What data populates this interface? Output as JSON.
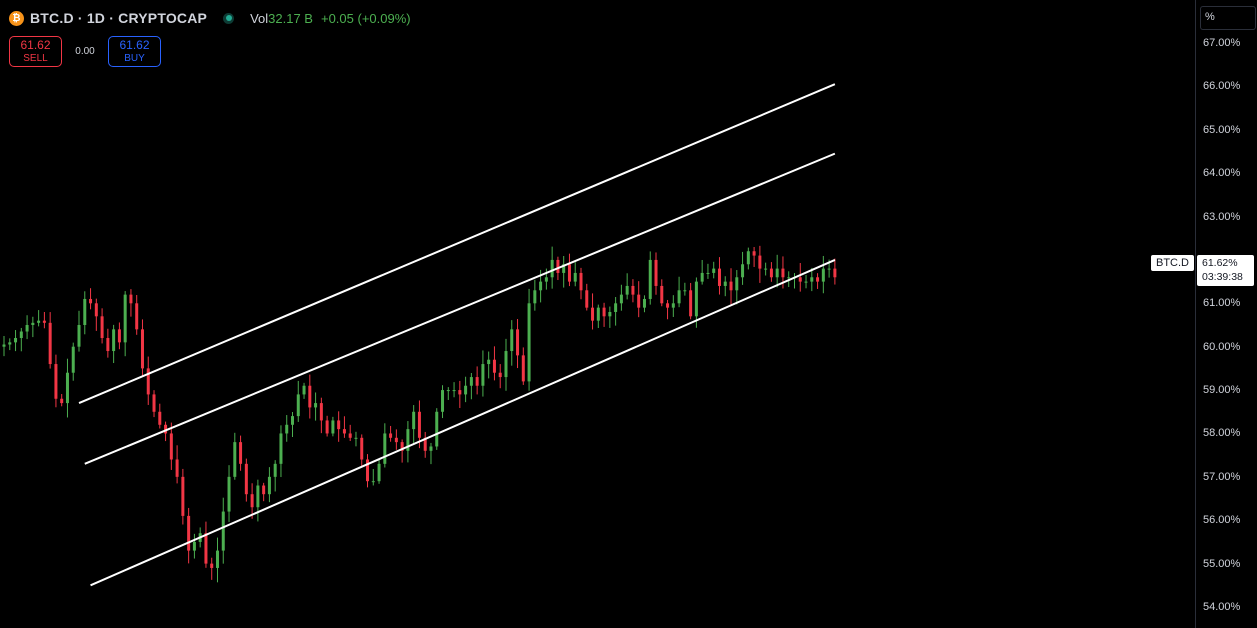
{
  "header": {
    "coin_glyph": "₿",
    "symbol": "BTC.D · 1D · CRYPTOCAP",
    "vol_label": "Vol",
    "vol_value": "32.17 B",
    "change": "+0.05 (+0.09%)"
  },
  "trade": {
    "sell_price": "61.62",
    "sell_label": "SELL",
    "spread": "0.00",
    "buy_price": "61.62",
    "buy_label": "BUY"
  },
  "axis": {
    "unit": "%",
    "ticks": [
      "67.00%",
      "66.00%",
      "65.00%",
      "64.00%",
      "63.00%",
      "62.00%",
      "61.00%",
      "60.00%",
      "59.00%",
      "58.00%",
      "57.00%",
      "56.00%",
      "55.00%",
      "54.00%"
    ]
  },
  "last_price": {
    "symbol_tag": "BTC.D",
    "value": "61.62%",
    "countdown": "03:39:38"
  },
  "colors": {
    "up": "#4caf50",
    "down": "#f23645",
    "background": "#000000",
    "channel": "#ffffff"
  },
  "chart_data": {
    "type": "candlestick",
    "symbol": "BTC.D",
    "interval": "1D",
    "ylim": [
      53.85,
      67.3
    ],
    "close": [
      60.05,
      60.1,
      60.2,
      60.35,
      60.5,
      60.55,
      60.6,
      60.55,
      59.6,
      58.8,
      58.7,
      59.4,
      60.0,
      60.5,
      61.1,
      61.0,
      60.7,
      60.2,
      59.9,
      60.4,
      60.1,
      61.2,
      61.0,
      60.4,
      59.5,
      58.9,
      58.5,
      58.2,
      58.0,
      57.4,
      57.0,
      56.1,
      55.3,
      55.5,
      55.7,
      55.0,
      54.9,
      55.3,
      56.2,
      57.0,
      57.8,
      57.3,
      56.6,
      56.3,
      56.8,
      56.6,
      57.0,
      57.3,
      58.0,
      58.2,
      58.4,
      58.9,
      59.1,
      58.6,
      58.7,
      58.3,
      58.0,
      58.3,
      58.1,
      58.0,
      57.9,
      57.9,
      57.4,
      56.9,
      56.9,
      57.3,
      58.0,
      57.9,
      57.8,
      57.6,
      58.1,
      58.5,
      57.9,
      57.6,
      57.7,
      58.5,
      59.0,
      59.0,
      59.0,
      58.9,
      59.1,
      59.3,
      59.1,
      59.6,
      59.7,
      59.4,
      59.3,
      59.9,
      60.4,
      59.8,
      59.2,
      61.0,
      61.3,
      61.5,
      61.6,
      62.0,
      61.7,
      61.9,
      61.5,
      61.7,
      61.3,
      60.9,
      60.6,
      60.9,
      60.7,
      60.8,
      61.0,
      61.2,
      61.4,
      61.2,
      60.9,
      61.1,
      62.0,
      61.4,
      61.0,
      60.9,
      61.0,
      61.3,
      61.3,
      60.7,
      61.5,
      61.7,
      61.7,
      61.8,
      61.4,
      61.5,
      61.3,
      61.6,
      61.9,
      62.2,
      62.1,
      61.8,
      61.8,
      61.6,
      61.8,
      61.6,
      61.6,
      61.6,
      61.5,
      61.5,
      61.6,
      61.5,
      61.8,
      61.8,
      61.6
    ],
    "channel_lines": [
      {
        "x1": 13,
        "y1": 58.7,
        "x2": 144,
        "y2": 66.05
      },
      {
        "x1": 14,
        "y1": 57.3,
        "x2": 144,
        "y2": 64.45
      },
      {
        "x1": 15,
        "y1": 54.5,
        "x2": 144,
        "y2": 62.0
      }
    ],
    "last_value": 61.62
  }
}
